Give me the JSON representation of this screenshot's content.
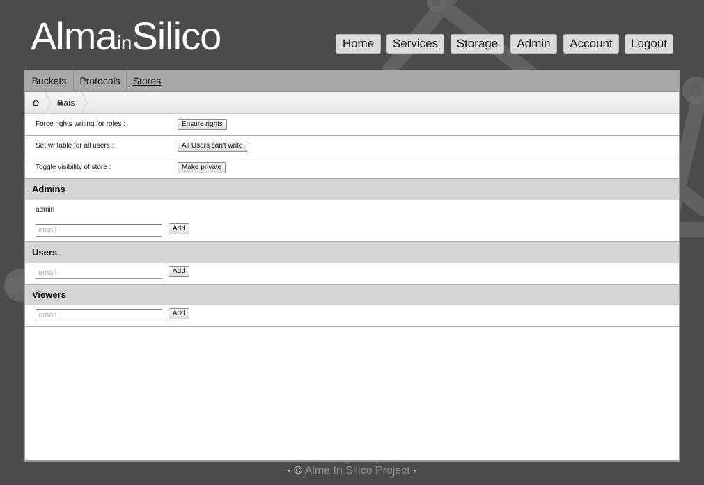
{
  "logo": {
    "part1": "Alma",
    "part2": "in",
    "part3": "Silico"
  },
  "nav": [
    {
      "label": "Home"
    },
    {
      "label": "Services"
    },
    {
      "label": "Storage"
    },
    {
      "label": "Admin"
    },
    {
      "label": "Account"
    },
    {
      "label": "Logout"
    }
  ],
  "tabs": [
    {
      "label": "Buckets"
    },
    {
      "label": "Protocols"
    },
    {
      "label": "Stores",
      "active": true
    }
  ],
  "breadcrumb": {
    "home_icon": "home-icon",
    "store_icon": "lock-icon",
    "store_label": "ais"
  },
  "settings": [
    {
      "label": "Force rights writing for roles :",
      "button": "Ensure rights"
    },
    {
      "label": "Set writable for all users :",
      "button": "All Users can't write"
    },
    {
      "label": "Toggle visibility of store :",
      "button": "Make private"
    }
  ],
  "sections": {
    "admins": {
      "title": "Admins",
      "members": [
        "admin"
      ],
      "placeholder": "email",
      "add_label": "Add"
    },
    "users": {
      "title": "Users",
      "placeholder": "email",
      "add_label": "Add"
    },
    "viewers": {
      "title": "Viewers",
      "placeholder": "email",
      "add_label": "Add"
    }
  },
  "footer": {
    "prefix": "- © ",
    "link": "Alma In Silico Project",
    "suffix": " -"
  },
  "colors": {
    "background": "#4a4b4d",
    "panel": "#ffffff",
    "tabbar": "#a8a8a8",
    "section_header": "#d6d6d6"
  }
}
